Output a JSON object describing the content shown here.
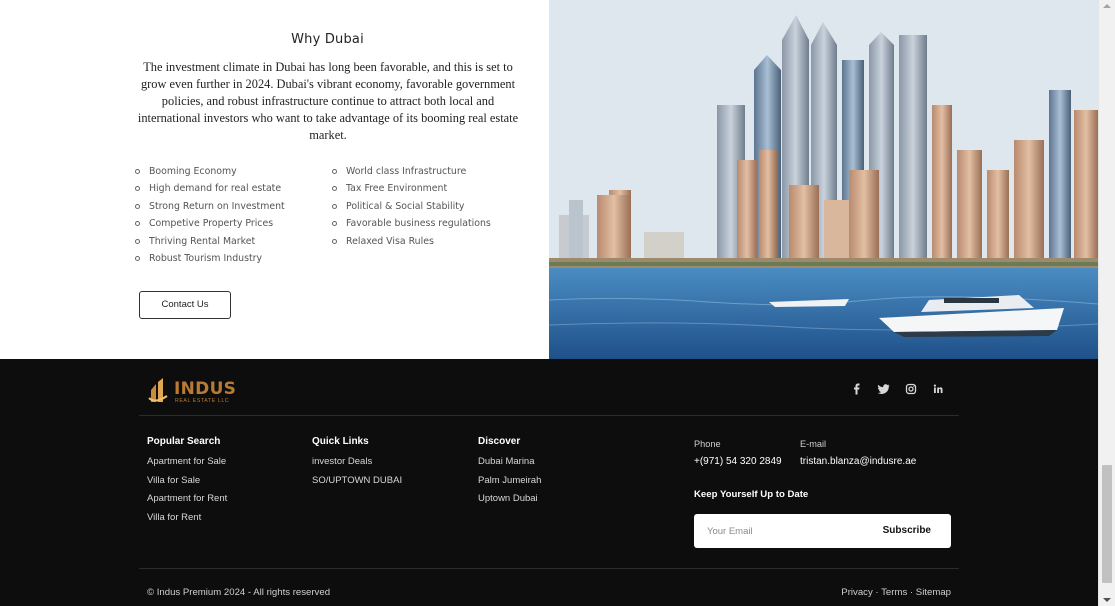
{
  "why_dubai": {
    "title": "Why Dubai",
    "paragraph": "The investment climate in Dubai has long been favorable, and this is set to grow even further in 2024. Dubai's vibrant economy, favorable government policies, and robust infrastructure continue to attract both local and international investors who want to take advantage of its booming real estate market.",
    "bullets_left": [
      "Booming Economy",
      "High demand for real estate",
      "Strong Return on Investment",
      "Competive Property Prices",
      "Thriving Rental Market",
      "Robust Tourism Industry"
    ],
    "bullets_right": [
      "World class Infrastructure",
      "Tax Free Environment",
      "Political & Social Stability",
      "Favorable business regulations",
      "Relaxed Visa Rules"
    ],
    "contact_button": "Contact Us"
  },
  "footer": {
    "logo": {
      "name": "INDUS",
      "subtitle": "REAL ESTATE LLC"
    },
    "socials": [
      "facebook-icon",
      "twitter-icon",
      "instagram-icon",
      "linkedin-icon"
    ],
    "popular_search": {
      "heading": "Popular Search",
      "links": [
        "Apartment for Sale",
        "Villa for Sale",
        "Apartment for Rent",
        "Villa for Rent"
      ]
    },
    "quick_links": {
      "heading": "Quick Links",
      "links": [
        "investor Deals",
        "SO/UPTOWN DUBAI"
      ]
    },
    "discover": {
      "heading": "Discover",
      "links": [
        "Dubai Marina",
        "Palm Jumeirah",
        "Uptown Dubai"
      ]
    },
    "contact": {
      "phone_label": "Phone",
      "phone": "+(971) 54 320 2849",
      "email_label": "E-mail",
      "email": "tristan.blanza@indusre.ae"
    },
    "newsletter": {
      "title": "Keep Yourself Up to Date",
      "placeholder": "Your Email",
      "button": "Subscribe"
    },
    "copyright": "© Indus Premium 2024 - All rights reserved",
    "legal": {
      "privacy": "Privacy",
      "terms": "Terms",
      "sitemap": "Sitemap",
      "separator": "·"
    }
  },
  "colors": {
    "footer_bg": "#0d0d0d",
    "brand_gold": "#b97a33",
    "sea_blue": "#2d6aa8"
  }
}
